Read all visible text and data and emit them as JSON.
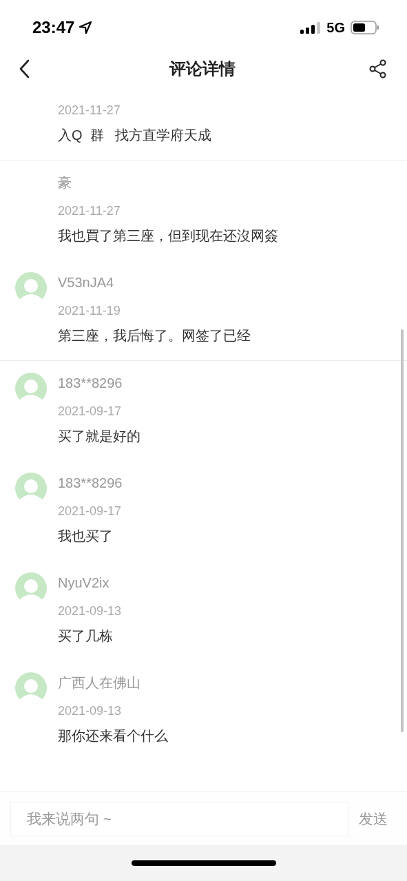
{
  "status_bar": {
    "time": "23:47",
    "network": "5G"
  },
  "header": {
    "title": "评论详情"
  },
  "comments": [
    {
      "avatar": false,
      "date": "2021-11-27",
      "text": "入Q  群   找方直学府天成",
      "divider_after": true
    },
    {
      "avatar": false,
      "name": "豪",
      "date": "2021-11-27",
      "text": "我也買了第三座，但到现在还沒网簽",
      "divider_after": false
    },
    {
      "avatar": true,
      "name": "V53nJA4",
      "date": "2021-11-19",
      "text": "第三座，我后悔了。网签了已经",
      "divider_after": true
    },
    {
      "avatar": true,
      "name": "183**8296",
      "date": "2021-09-17",
      "text": "买了就是好的",
      "divider_after": false
    },
    {
      "avatar": true,
      "name": "183**8296",
      "date": "2021-09-17",
      "text": "我也买了",
      "divider_after": false
    },
    {
      "avatar": true,
      "name": "NyuV2ix",
      "date": "2021-09-13",
      "text": "买了几栋",
      "divider_after": false
    },
    {
      "avatar": true,
      "name": "广西人在佛山",
      "date": "2021-09-13",
      "text": "那你还来看个什么",
      "divider_after": false
    }
  ],
  "composer": {
    "placeholder": "我来说两句 ~",
    "send": "发送"
  }
}
